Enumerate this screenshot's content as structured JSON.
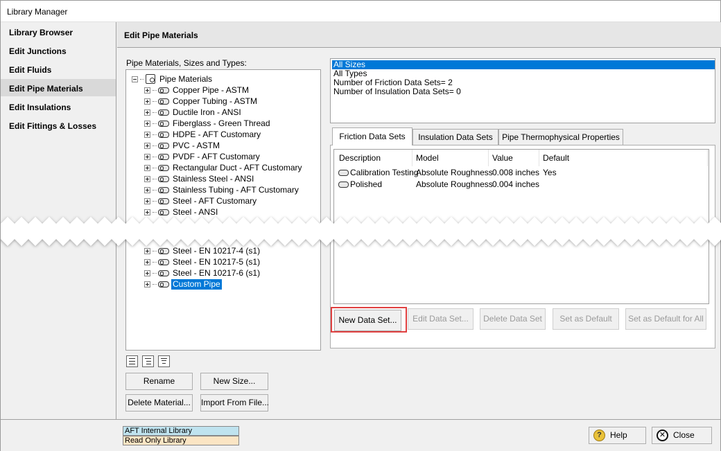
{
  "window": {
    "title": "Library Manager"
  },
  "sidebar": {
    "items": [
      {
        "label": "Library Browser"
      },
      {
        "label": "Edit Junctions"
      },
      {
        "label": "Edit Fluids"
      },
      {
        "label": "Edit Pipe Materials",
        "selected": true
      },
      {
        "label": "Edit Insulations"
      },
      {
        "label": "Edit Fittings & Losses"
      }
    ]
  },
  "panel": {
    "title": "Edit Pipe Materials"
  },
  "tree": {
    "label": "Pipe Materials, Sizes and Types:",
    "root": "Pipe Materials",
    "items_top": [
      "Copper Pipe - ASTM",
      "Copper Tubing - ASTM",
      "Ductile Iron - ANSI",
      "Fiberglass - Green Thread",
      "HDPE - AFT Customary",
      "PVC - ASTM",
      "PVDF - AFT Customary",
      "Rectangular Duct - AFT Customary",
      "Stainless Steel - ANSI",
      "Stainless Tubing - AFT Customary",
      "Steel - AFT Customary",
      "Steel - ANSI"
    ],
    "items_bottom": [
      "Steel - EN 10217-4 (s1)",
      "Steel - EN 10217-5 (s1)",
      "Steel - EN 10217-6 (s1)",
      "Custom Pipe"
    ],
    "selected": "Custom Pipe"
  },
  "info": {
    "lines": [
      "All Sizes",
      "All Types",
      "Number of Friction Data Sets= 2",
      "Number of Insulation Data Sets= 0"
    ]
  },
  "tabs": [
    {
      "label": "Friction Data Sets",
      "active": true
    },
    {
      "label": "Insulation Data Sets"
    },
    {
      "label": "Pipe Thermophysical Properties"
    }
  ],
  "grid": {
    "columns": [
      "Description",
      "Model",
      "Value",
      "Default"
    ],
    "rows": [
      {
        "description": "Calibration Testing",
        "model": "Absolute Roughness",
        "value": "0.008 inches",
        "default": "Yes"
      },
      {
        "description": "Polished",
        "model": "Absolute Roughness",
        "value": "0.004 inches",
        "default": ""
      }
    ]
  },
  "data_set_buttons": {
    "new": "New Data Set...",
    "edit": "Edit Data Set...",
    "delete": "Delete Data Set",
    "set_default": "Set as Default",
    "set_default_all": "Set as Default for All"
  },
  "tree_buttons": {
    "rename": "Rename",
    "new_size": "New Size...",
    "delete_material": "Delete Material...",
    "import": "Import From File..."
  },
  "legend": {
    "internal": "AFT Internal Library",
    "readonly": "Read Only Library",
    "internal_color": "#bfe3ef",
    "readonly_color": "#fbe5c4"
  },
  "footer_buttons": {
    "help": "Help",
    "close": "Close"
  }
}
